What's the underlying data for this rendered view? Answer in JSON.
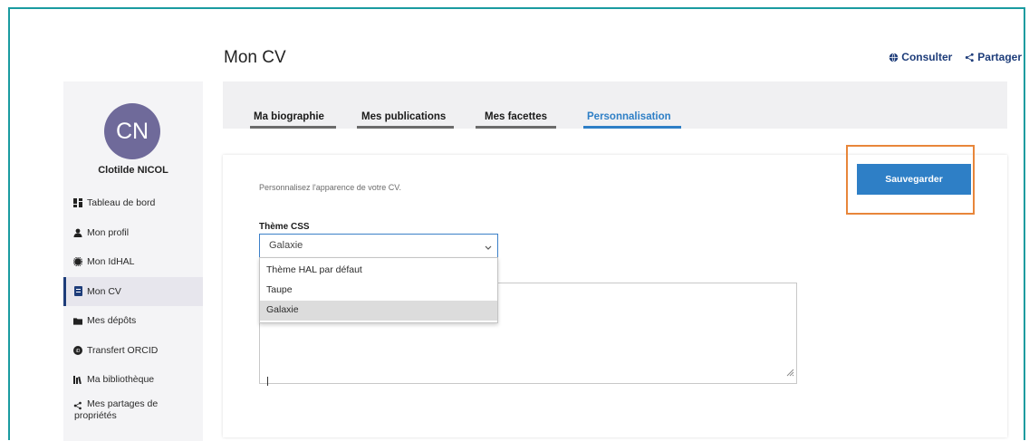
{
  "page": {
    "title": "Mon CV"
  },
  "actions": {
    "consult": "Consulter",
    "share": "Partager"
  },
  "user": {
    "initials": "CN",
    "name": "Clotilde NICOL"
  },
  "sidebar": {
    "items": [
      {
        "label": "Tableau de bord",
        "icon": "dashboard-icon"
      },
      {
        "label": "Mon profil",
        "icon": "user-icon"
      },
      {
        "label": "Mon IdHAL",
        "icon": "idhal-icon"
      },
      {
        "label": "Mon CV",
        "icon": "cv-icon",
        "active": true
      },
      {
        "label": "Mes dépôts",
        "icon": "folder-icon"
      },
      {
        "label": "Transfert ORCID",
        "icon": "orcid-icon"
      },
      {
        "label": "Ma bibliothèque",
        "icon": "library-icon"
      },
      {
        "label": "Mes partages de propriétés",
        "icon": "share-icon"
      }
    ]
  },
  "tabs": [
    {
      "label": "Ma biographie"
    },
    {
      "label": "Mes publications"
    },
    {
      "label": "Mes facettes"
    },
    {
      "label": "Personnalisation",
      "active": true
    }
  ],
  "content": {
    "hint": "Personnalisez l'apparence de votre CV.",
    "save_label": "Sauvegarder",
    "css_label": "Thème CSS",
    "select_value": "Galaxie",
    "options": [
      "Thème HAL par défaut",
      "Taupe",
      "Galaxie"
    ]
  },
  "colors": {
    "accent": "#2e7fc6",
    "highlight": "#e8863a",
    "frame": "#1a9ba0",
    "avatar": "#6f6a9a"
  }
}
